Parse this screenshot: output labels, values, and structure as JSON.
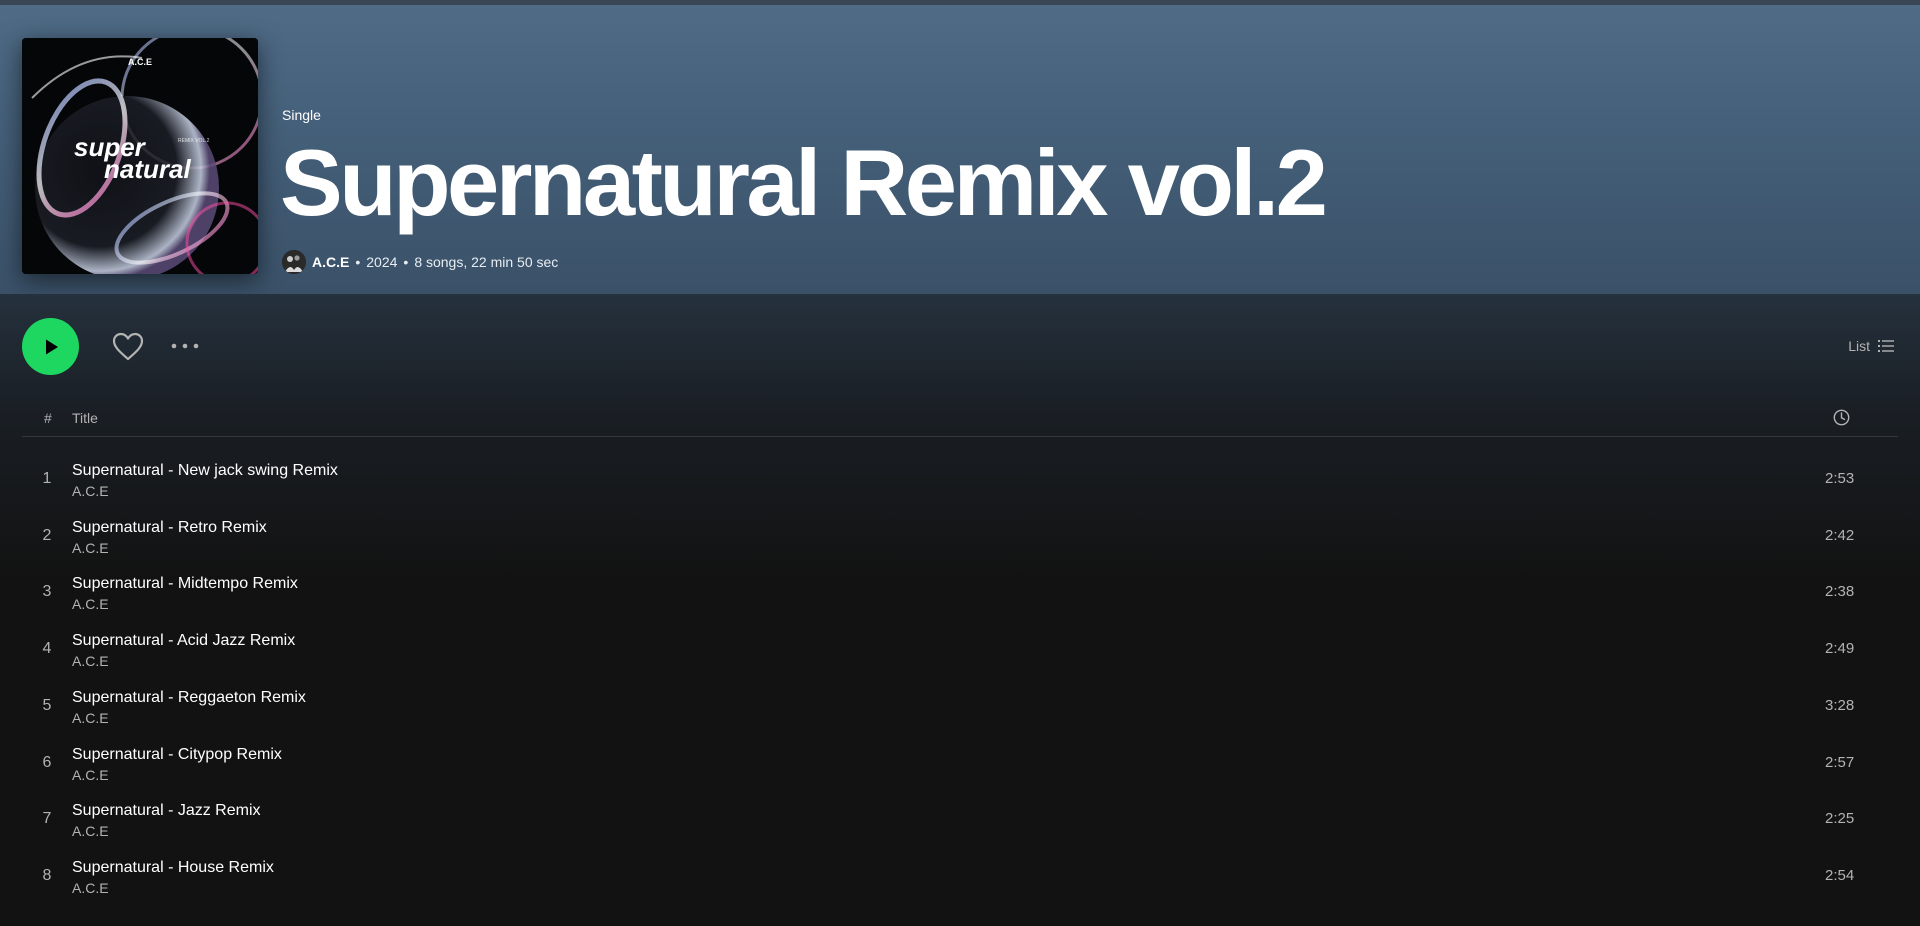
{
  "header": {
    "type_label": "Single",
    "album_title": "Supernatural Remix vol.2",
    "artist": "A.C.E",
    "year": "2024",
    "summary": "8 songs, 22 min 50 sec",
    "separator": "•"
  },
  "cover": {
    "logo_text": "A.C.E",
    "art_text_line1": "super",
    "art_text_line2": "natural",
    "art_subtext": "REMIX VOL.2"
  },
  "actions": {
    "view_label": "List"
  },
  "table": {
    "num_header": "#",
    "title_header": "Title"
  },
  "tracks": [
    {
      "num": "1",
      "title": "Supernatural - New jack swing Remix",
      "artist": "A.C.E",
      "duration": "2:53"
    },
    {
      "num": "2",
      "title": "Supernatural - Retro Remix",
      "artist": "A.C.E",
      "duration": "2:42"
    },
    {
      "num": "3",
      "title": "Supernatural - Midtempo Remix",
      "artist": "A.C.E",
      "duration": "2:38"
    },
    {
      "num": "4",
      "title": "Supernatural - Acid Jazz Remix",
      "artist": "A.C.E",
      "duration": "2:49"
    },
    {
      "num": "5",
      "title": "Supernatural - Reggaeton Remix",
      "artist": "A.C.E",
      "duration": "3:28"
    },
    {
      "num": "6",
      "title": "Supernatural - Citypop Remix",
      "artist": "A.C.E",
      "duration": "2:57"
    },
    {
      "num": "7",
      "title": "Supernatural - Jazz Remix",
      "artist": "A.C.E",
      "duration": "2:25"
    },
    {
      "num": "8",
      "title": "Supernatural - House Remix",
      "artist": "A.C.E",
      "duration": "2:54"
    }
  ],
  "colors": {
    "accent_green": "#1ed760",
    "hero_blue": "#4f6b86",
    "background": "#121212",
    "muted_text": "#b3b3b3"
  },
  "icons": {
    "play": "play-icon",
    "heart": "heart-icon",
    "more": "more-options-icon",
    "list_view": "list-view-icon",
    "duration": "clock-icon"
  }
}
